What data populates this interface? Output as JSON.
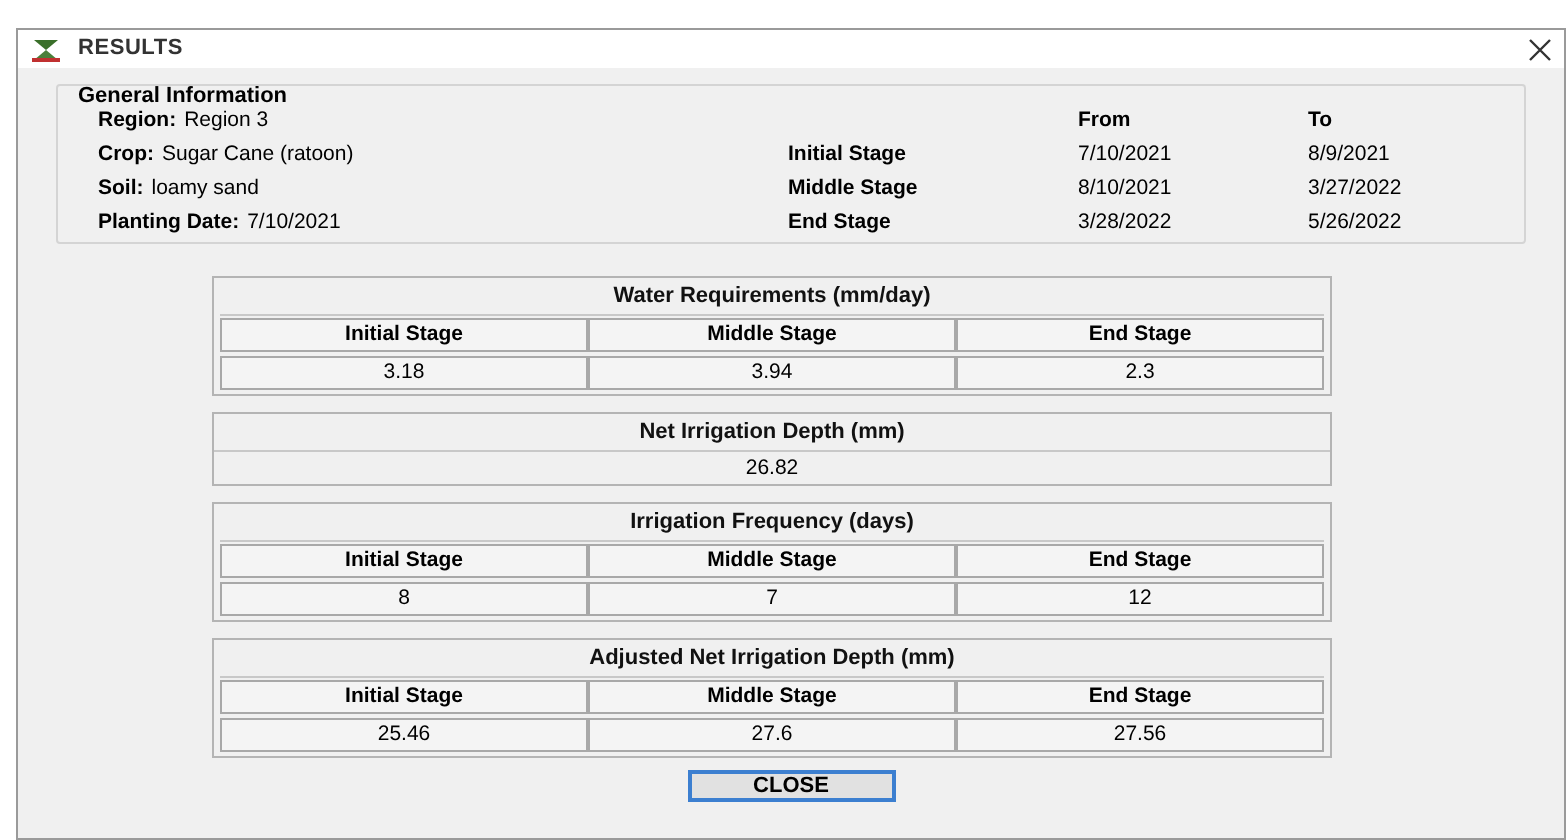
{
  "window": {
    "title": "RESULTS"
  },
  "general_information": {
    "title": "General Information",
    "fields": [
      {
        "label": "Region:",
        "value": "Region 3"
      },
      {
        "label": "Crop:",
        "value": "Sugar Cane (ratoon)"
      },
      {
        "label": "Soil:",
        "value": "loamy sand"
      },
      {
        "label": "Planting Date:",
        "value": "7/10/2021"
      }
    ],
    "stage_columns": [
      "From",
      "To"
    ],
    "stages": [
      {
        "name": "Initial Stage",
        "from": "7/10/2021",
        "to": "8/9/2021"
      },
      {
        "name": "Middle Stage",
        "from": "8/10/2021",
        "to": "3/27/2022"
      },
      {
        "name": "End Stage",
        "from": "3/28/2022",
        "to": "5/26/2022"
      }
    ]
  },
  "sections": [
    {
      "kind": "stages",
      "title": "Water Requirements (mm/day)",
      "columns": [
        "Initial Stage",
        "Middle Stage",
        "End Stage"
      ],
      "values": [
        "3.18",
        "3.94",
        "2.3"
      ]
    },
    {
      "kind": "single",
      "title": "Net Irrigation Depth (mm)",
      "values": [
        "26.82"
      ]
    },
    {
      "kind": "stages",
      "title": "Irrigation Frequency (days)",
      "columns": [
        "Initial Stage",
        "Middle Stage",
        "End Stage"
      ],
      "values": [
        "8",
        "7",
        "12"
      ]
    },
    {
      "kind": "stages",
      "title": "Adjusted Net Irrigation Depth (mm)",
      "columns": [
        "Initial Stage",
        "Middle Stage",
        "End Stage"
      ],
      "values": [
        "25.46",
        "27.6",
        "27.56"
      ]
    }
  ],
  "close_button": "CLOSE"
}
